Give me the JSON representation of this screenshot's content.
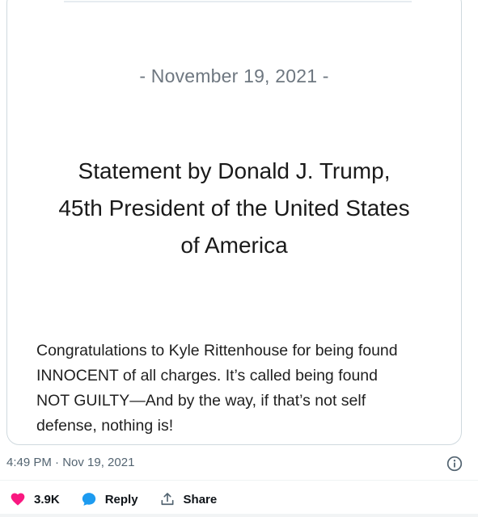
{
  "statement": {
    "date": "- November 19, 2021 -",
    "title_lines": [
      "Statement by Donald J. Trump,",
      "45th President of the United States",
      "of America"
    ],
    "body_lines": [
      "Congratulations to Kyle Rittenhouse for being found",
      "INNOCENT of all charges. It’s called being found",
      "NOT GUILTY—And by the way, if that’s not self",
      "defense, nothing is!"
    ]
  },
  "tweet": {
    "timestamp": "4:49 PM · Nov 19, 2021"
  },
  "actions": {
    "like_count": "3.9K",
    "reply_label": "Reply",
    "share_label": "Share"
  },
  "colors": {
    "like": "#f91880",
    "reply": "#1d9bf0",
    "text": "#0f1419",
    "muted": "#536471"
  },
  "icons": {
    "like": "heart-icon",
    "reply": "speech-bubble-icon",
    "share": "share-arrow-icon",
    "info": "info-icon"
  }
}
